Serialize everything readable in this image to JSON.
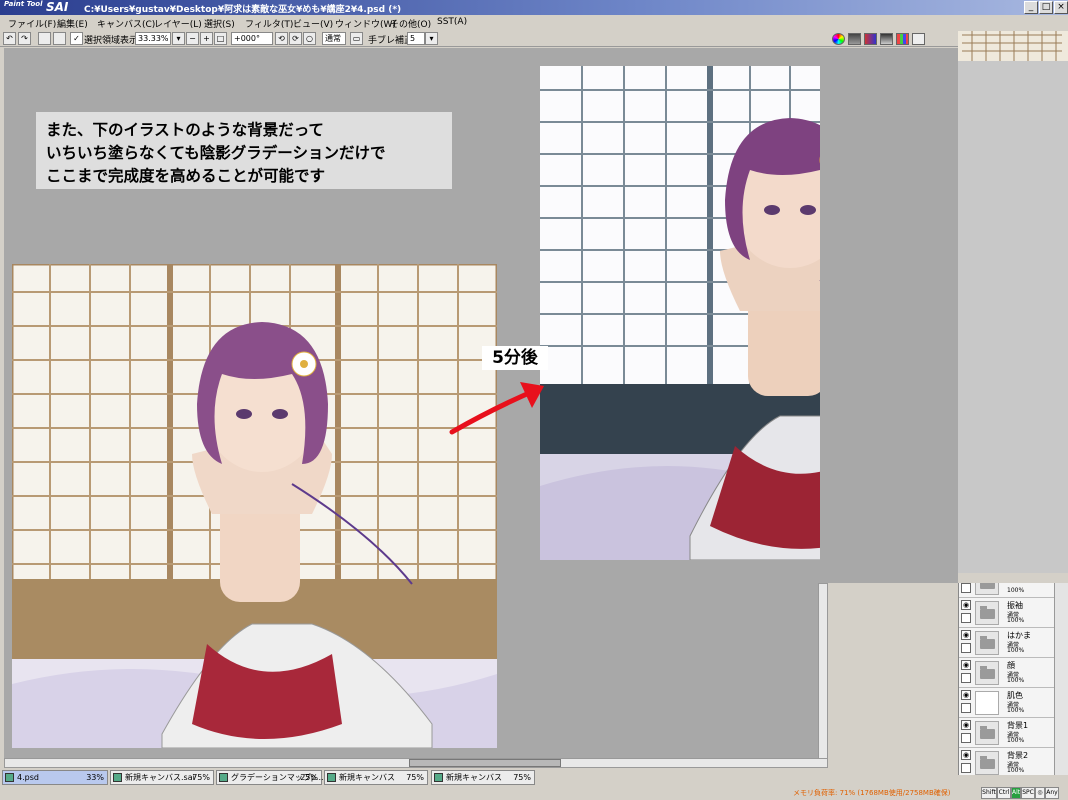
{
  "app": {
    "logo_small": "Paint Tool",
    "logo_big": "SAI",
    "title": "C:¥Users¥gustav¥Desktop¥阿求は素敵な巫女¥めも¥講座2¥4.psd (*)"
  },
  "window_controls": {
    "minimize": "_",
    "maximize": "□",
    "close": "×"
  },
  "menu": [
    "ファイル(F)",
    "編集(E)",
    "キャンバス(C)",
    "レイヤー(L)",
    "選択(S)",
    "フィルタ(T)",
    "ビュー(V)",
    "ウィンドウ(W)",
    "その他(O)",
    "SST(A)"
  ],
  "toolbar": {
    "selection_checkbox_label": "選択領域表示",
    "zoom": "33.33%",
    "rotation": "+000°",
    "blend_mode": "通常",
    "stabilizer_label": "手ブレ補正",
    "stabilizer_value": "5"
  },
  "canvas": {
    "caption_lines": [
      "また、下のイラストのような背景だって",
      "いちいち塗らなくても陰影グラデーションだけで",
      "ここまで完成度を高めることが可能です"
    ],
    "after_label": "5分後",
    "arrow_color": "#e8101c"
  },
  "layers": [
    {
      "name": "",
      "mode": "",
      "opacity": "100%",
      "type": "folder"
    },
    {
      "name": "振袖",
      "mode": "通常",
      "opacity": "100%",
      "type": "folder"
    },
    {
      "name": "はかま",
      "mode": "通常",
      "opacity": "100%",
      "type": "folder"
    },
    {
      "name": "顔",
      "mode": "通常",
      "opacity": "100%",
      "type": "folder"
    },
    {
      "name": "肌色",
      "mode": "通常",
      "opacity": "100%",
      "type": "image"
    },
    {
      "name": "背景1",
      "mode": "通常",
      "opacity": "100%",
      "type": "folder"
    },
    {
      "name": "背景2",
      "mode": "通常",
      "opacity": "100%",
      "type": "folder"
    }
  ],
  "doc_tabs": [
    {
      "name": "4.psd",
      "zoom": "33%",
      "active": true
    },
    {
      "name": "新規キャンバス.sai",
      "zoom": "75%",
      "active": false
    },
    {
      "name": "グラデーションマップp...",
      "zoom": "25%",
      "active": false
    },
    {
      "name": "新規キャンバス",
      "zoom": "75%",
      "active": false
    },
    {
      "name": "新規キャンバス",
      "zoom": "75%",
      "active": false
    }
  ],
  "status": {
    "memory": "メモリ負荷率: 71% (1768MB使用/2758MB確保)",
    "keys": [
      "Shift",
      "Ctrl",
      "Alt",
      "SPC",
      "◎",
      "Any"
    ]
  }
}
